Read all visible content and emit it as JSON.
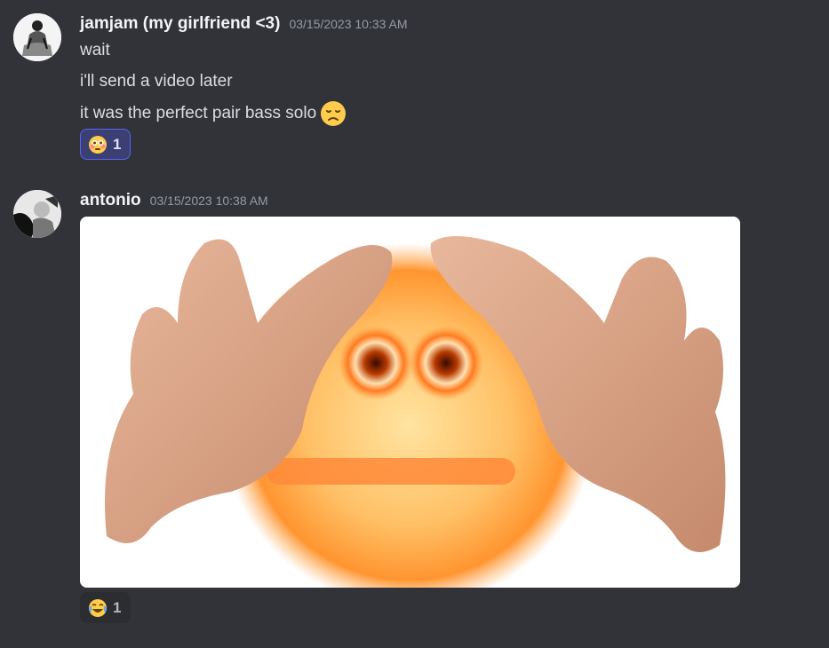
{
  "messages": [
    {
      "author": "jamjam (my girlfriend <3)",
      "timestamp": "03/15/2023 10:33 AM",
      "avatar_icon": "user-avatar-icon",
      "lines": [
        "wait",
        "i'll send a video later",
        "it was the perfect pair bass solo"
      ],
      "inline_emoji": "disappointed-face-emoji",
      "reaction": {
        "emoji": "flushed-face-emoji",
        "count": "1",
        "reacted_by_me": true
      }
    },
    {
      "author": "antonio",
      "timestamp": "03/15/2023 10:38 AM",
      "avatar_icon": "user-avatar-icon",
      "attachment": {
        "type": "image",
        "depicts": "cursed-emoji-with-hands-image"
      },
      "reaction": {
        "emoji": "crying-laughing-face-emoji",
        "count": "1",
        "reacted_by_me": false
      }
    }
  ],
  "colors": {
    "background": "#313338",
    "username": "#f2f3f5",
    "timestamp": "#949ba4",
    "text": "#dbdee1",
    "reaction_active_bg": "#3b3f74",
    "reaction_active_border": "#5865f2"
  }
}
